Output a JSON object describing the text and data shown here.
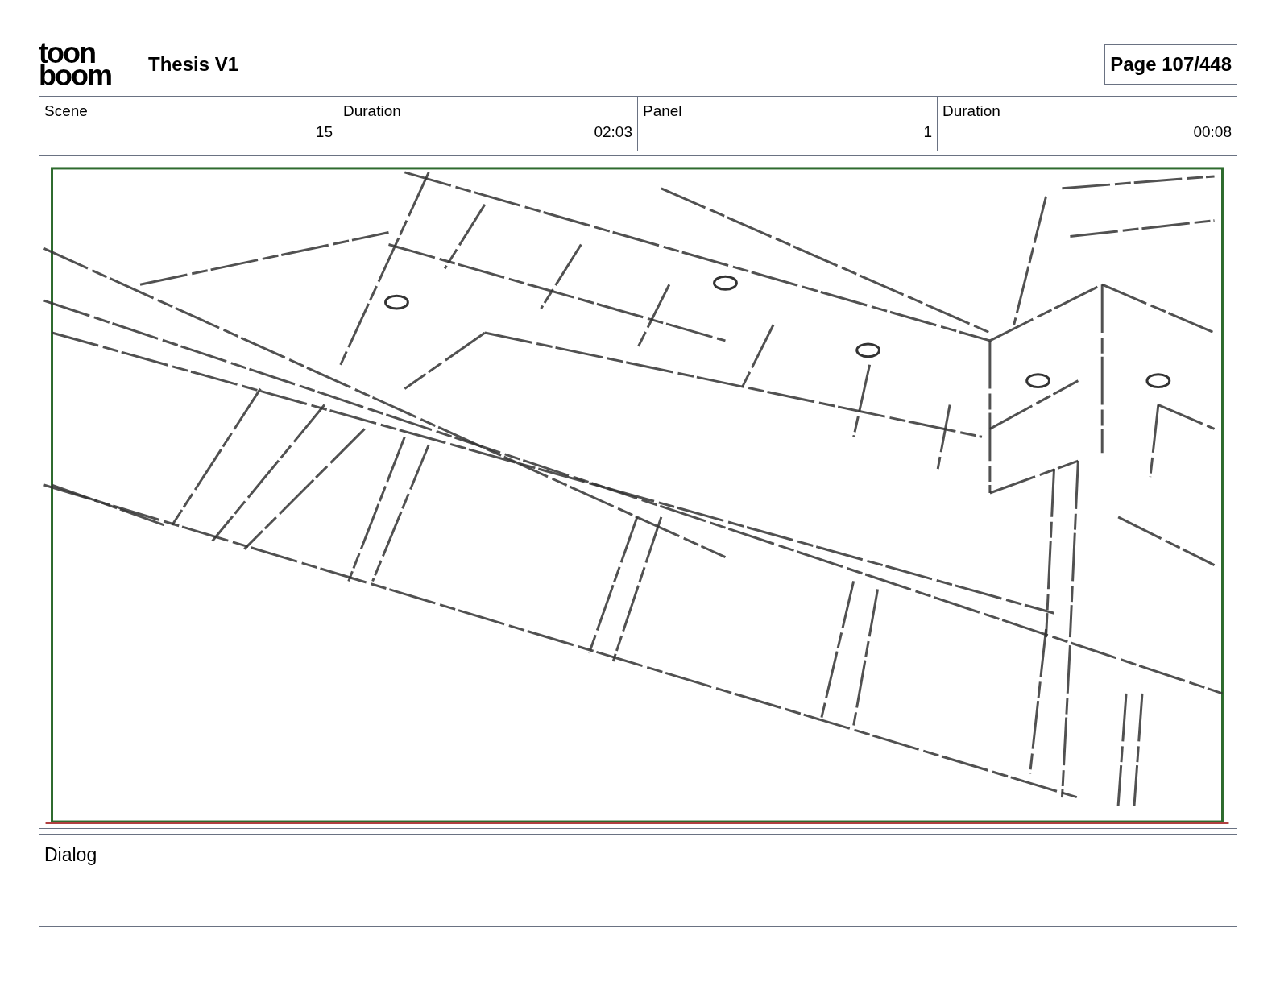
{
  "header": {
    "logo": [
      "toon",
      "boom"
    ],
    "title": "Thesis V1",
    "page": "Page 107/448"
  },
  "info_table": {
    "columns": [
      "Scene",
      "Duration",
      "Panel",
      "Duration"
    ],
    "row": [
      "15",
      "02:03",
      "1",
      "00:08"
    ]
  },
  "dialog": {
    "label": "Dialog"
  }
}
